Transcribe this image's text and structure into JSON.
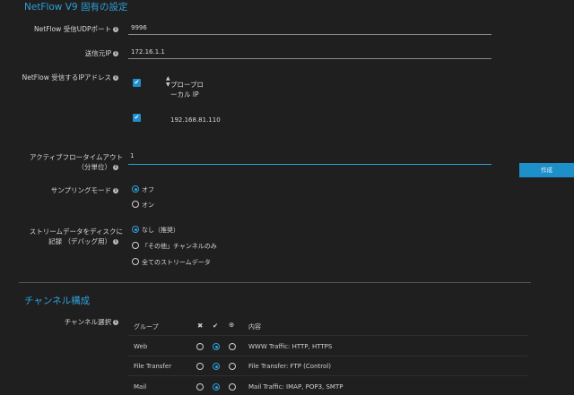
{
  "netflow": {
    "title": "NetFlow V9 固有の設定",
    "port_label": "NetFlow 受信UDPポート",
    "port_value": "9996",
    "source_ip_label": "送信元IP",
    "source_ip_value": "172.16.1.1",
    "receive_ip_label": "NetFlow 受信するIPアドレス",
    "sort_icon": "sort-icon",
    "proxy_ip_header_line1": "プロープロ",
    "proxy_ip_header_line2": "ーカル IP",
    "row_ip": "192.168.81.110",
    "timeout_label_line1": "アクティブフロータイムアウト",
    "timeout_label_line2": "（分単位）",
    "timeout_value": "1",
    "create_button": "作成",
    "sampling_label": "サンプリングモード",
    "sampling_options": [
      "オフ",
      "オン"
    ],
    "stream_label_line1": "ストリームデータをディスクに",
    "stream_label_line2": "記録 （デバッグ用）",
    "stream_options": [
      "なし（推奨）",
      "「その他」チャンネルのみ",
      "全てのストリームデータ"
    ]
  },
  "channels": {
    "title": "チャンネル構成",
    "select_label": "チャンネル選択",
    "headers": {
      "group": "グループ",
      "content": "内容"
    },
    "header_icons": [
      "x-icon",
      "check-icon",
      "zoom-icon"
    ],
    "rows": [
      {
        "group": "Web",
        "content": "WWW Traffic: HTTP, HTTPS",
        "selected": 1
      },
      {
        "group": "File Transfer",
        "content": "File Transfer: FTP (Control)",
        "selected": 1
      },
      {
        "group": "Mail",
        "content": "Mail Traffic: IMAP, POP3, SMTP",
        "selected": 1
      }
    ]
  },
  "colors": {
    "accent": "#2e9fd8",
    "background": "#1f1f1f",
    "button": "#1d8fc9"
  }
}
